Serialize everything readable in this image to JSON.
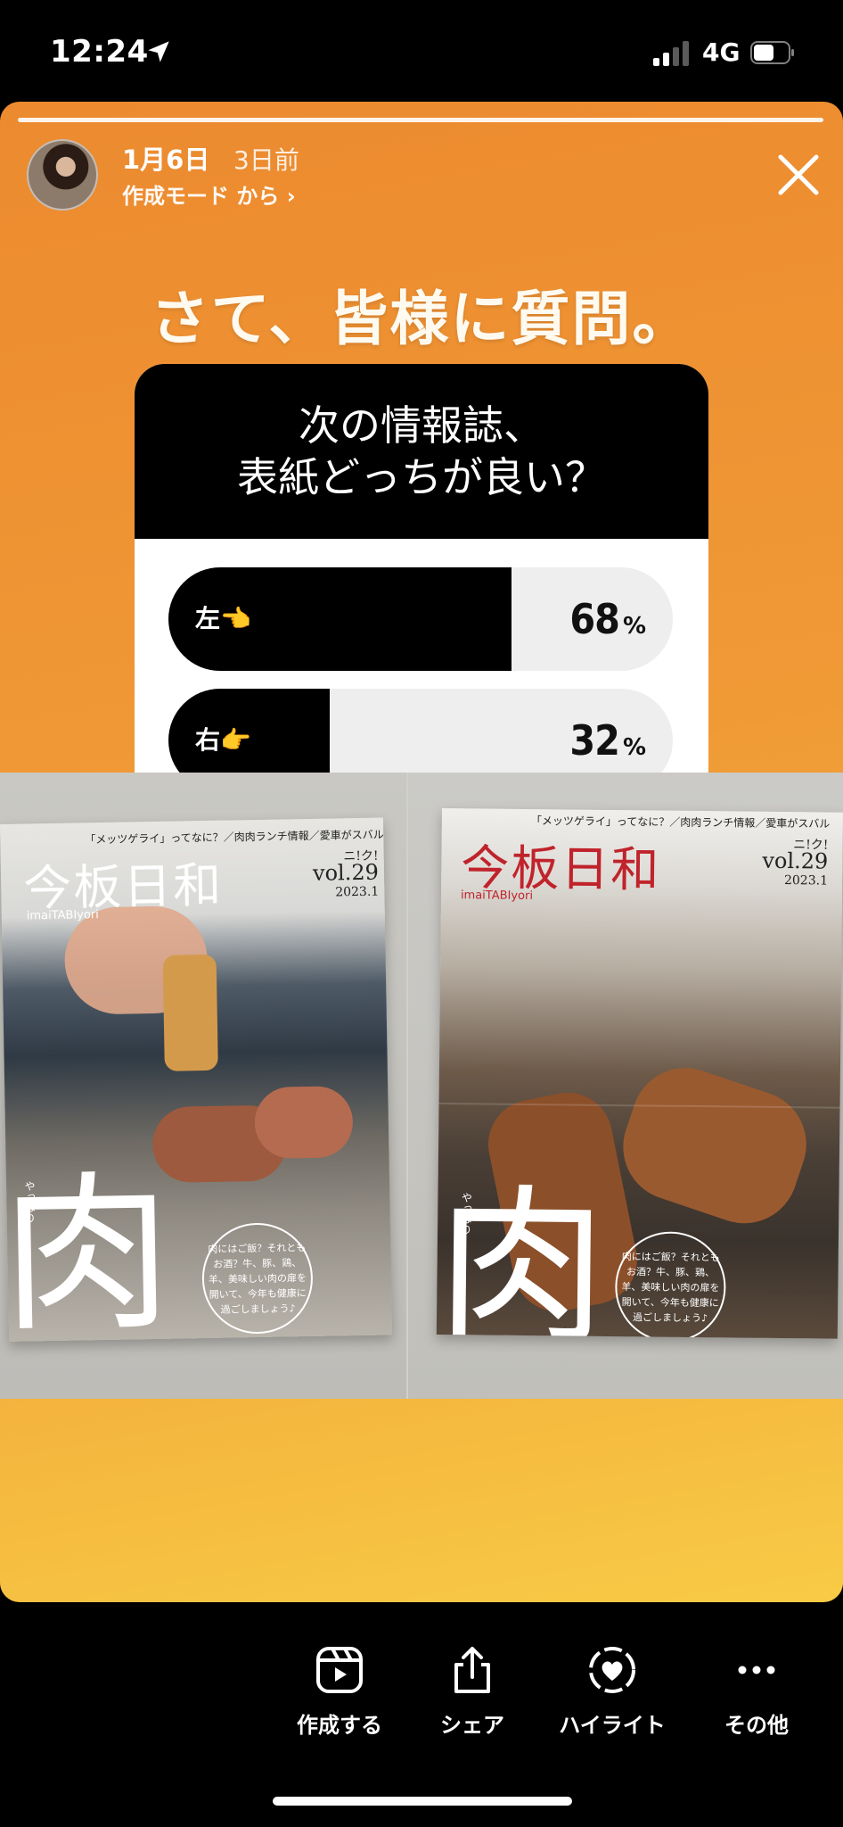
{
  "status_bar": {
    "time": "12:24",
    "network": "4G",
    "icons": [
      "location-arrow-icon",
      "signal-icon",
      "battery-icon"
    ]
  },
  "story": {
    "header": {
      "date": "1月6日",
      "ago": "3日前",
      "mode_link": "作成モード から ›"
    },
    "headline": "さて、皆様に質問。",
    "poll": {
      "question_line1": "次の情報誌、",
      "question_line2": "表紙どっちが良い？",
      "options": [
        {
          "label": "左👈",
          "percent": 68,
          "percent_text": "68",
          "unit": "%"
        },
        {
          "label": "右👉",
          "percent": 32,
          "percent_text": "32",
          "unit": "%"
        }
      ]
    },
    "photos": {
      "left": {
        "subtitle": "「メッツゲライ」ってなに？／肉肉ランチ情報／愛車がスバル",
        "title": "今板日和",
        "roman": "imaiTABIyori",
        "issue_label": "ニ!ク!",
        "vol": "vol.29",
        "year": "2023.1",
        "small_vertical": "やっぱり",
        "big_kanji": "肉",
        "blurb": "肉にはご飯？それともお酒？牛、豚、鶏、羊、美味しい肉の扉を開いて、今年も健康に過ごしましょう♪"
      },
      "right": {
        "subtitle": "「メッツゲライ」ってなに？／肉肉ランチ情報／愛車がスバル",
        "title": "今板日和",
        "roman": "imaiTABIyori",
        "issue_label": "ニ!ク!",
        "vol": "vol.29",
        "year": "2023.1",
        "small_vertical": "やっぱり",
        "big_kanji": "肉",
        "blurb": "肉にはご飯？それともお酒？牛、豚、鶏、羊、美味しい肉の扉を開いて、今年も健康に過ごしましょう♪"
      }
    }
  },
  "actions": [
    {
      "label": "作成する",
      "icon": "reels-create-icon"
    },
    {
      "label": "シェア",
      "icon": "share-icon"
    },
    {
      "label": "ハイライト",
      "icon": "highlight-heart-icon"
    },
    {
      "label": "その他",
      "icon": "more-icon"
    }
  ],
  "colors": {
    "gradient_top": "#ec8a2f",
    "gradient_bottom": "#f8cb45",
    "poll_bar": "#000000",
    "poll_track": "#eeeeee",
    "magazine_title_red": "#c0232b"
  }
}
